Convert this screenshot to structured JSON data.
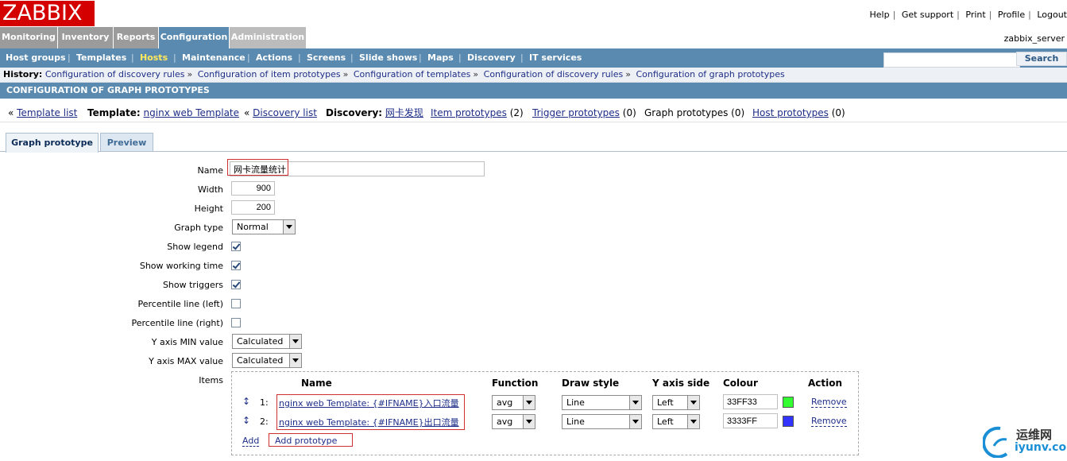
{
  "app": {
    "logo": "ZABBIX",
    "server_name": "zabbix_server"
  },
  "top_links": [
    "Help",
    "Get support",
    "Print",
    "Profile",
    "Logout"
  ],
  "main_menu": [
    "Monitoring",
    "Inventory",
    "Reports",
    "Configuration",
    "Administration"
  ],
  "main_menu_active": "Configuration",
  "sub_menu": [
    "Host groups",
    "Templates",
    "Hosts",
    "Maintenance",
    "Actions",
    "Screens",
    "Slide shows",
    "Maps",
    "Discovery",
    "IT services"
  ],
  "sub_menu_active": "Hosts",
  "search": {
    "value": "",
    "button": "Search"
  },
  "history": {
    "label": "History:",
    "items": [
      "Configuration of discovery rules",
      "Configuration of item prototypes",
      "Configuration of templates",
      "Configuration of discovery rules",
      "Configuration of graph prototypes"
    ]
  },
  "page_title": "CONFIGURATION OF GRAPH PROTOTYPES",
  "nav": {
    "template_list": "Template list",
    "template_label": "Template:",
    "template_name": "nginx web Template",
    "discovery_list": "Discovery list",
    "discovery_label": "Discovery:",
    "discovery_name": "网卡发现",
    "item_prototypes": "Item prototypes",
    "item_prototypes_count": "(2)",
    "trigger_prototypes": "Trigger prototypes",
    "trigger_prototypes_count": "(0)",
    "graph_prototypes": "Graph prototypes (0)",
    "host_prototypes": "Host prototypes",
    "host_prototypes_count": "(0)",
    "back_marker": "«"
  },
  "tabs": [
    "Graph prototype",
    "Preview"
  ],
  "form": {
    "name_label": "Name",
    "name_value": "网卡流量统计",
    "width_label": "Width",
    "width_value": "900",
    "height_label": "Height",
    "height_value": "200",
    "graph_type_label": "Graph type",
    "graph_type_value": "Normal",
    "show_legend_label": "Show legend",
    "show_legend": true,
    "show_working_time_label": "Show working time",
    "show_working_time": true,
    "show_triggers_label": "Show triggers",
    "show_triggers": true,
    "percentile_left_label": "Percentile line (left)",
    "percentile_left": false,
    "percentile_right_label": "Percentile line (right)",
    "percentile_right": false,
    "ymin_label": "Y axis MIN value",
    "ymin_value": "Calculated",
    "ymax_label": "Y axis MAX value",
    "ymax_value": "Calculated",
    "items_label": "Items"
  },
  "items_table": {
    "headers": [
      "Name",
      "Function",
      "Draw style",
      "Y axis side",
      "Colour",
      "Action"
    ],
    "rows": [
      {
        "index": "1:",
        "name": "nginx web Template: {#IFNAME}入口流量",
        "function": "avg",
        "draw_style": "Line",
        "y_axis_side": "Left",
        "colour": "33FF33",
        "swatch": "#33ff33",
        "action": "Remove"
      },
      {
        "index": "2:",
        "name": "nginx web Template: {#IFNAME}出口流量",
        "function": "avg",
        "draw_style": "Line",
        "y_axis_side": "Left",
        "colour": "3333FF",
        "swatch": "#3333ff",
        "action": "Remove"
      }
    ],
    "add": "Add",
    "add_prototype": "Add prototype"
  },
  "watermark": {
    "cn": "运维网",
    "url": "iyunv.com"
  },
  "colors": {
    "accent": "#5a8ab0",
    "logo_bg": "#d40000",
    "active_submenu": "#ffe85c",
    "link": "#1e2e88"
  }
}
